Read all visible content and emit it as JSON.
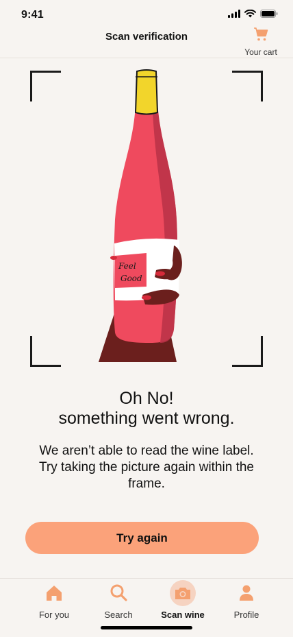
{
  "status_bar": {
    "time": "9:41"
  },
  "header": {
    "title": "Scan verification",
    "cart_label": "Your cart"
  },
  "bottle": {
    "label_text_line1": "Feel",
    "label_text_line2": "Good"
  },
  "message": {
    "title_line1": "Oh No!",
    "title_line2": "something went wrong.",
    "body": "We aren’t able to read the wine label. Try taking the picture again within the frame."
  },
  "actions": {
    "try_again_label": "Try again"
  },
  "tab_bar": {
    "tabs": [
      {
        "label": "For you",
        "icon": "home-icon"
      },
      {
        "label": "Search",
        "icon": "search-icon"
      },
      {
        "label": "Scan wine",
        "icon": "camera-icon",
        "active": true
      },
      {
        "label": "Profile",
        "icon": "profile-icon"
      }
    ]
  },
  "colors": {
    "accent": "#fba27a",
    "icon_accent": "#f4a06f",
    "background": "#f7f4f1"
  }
}
